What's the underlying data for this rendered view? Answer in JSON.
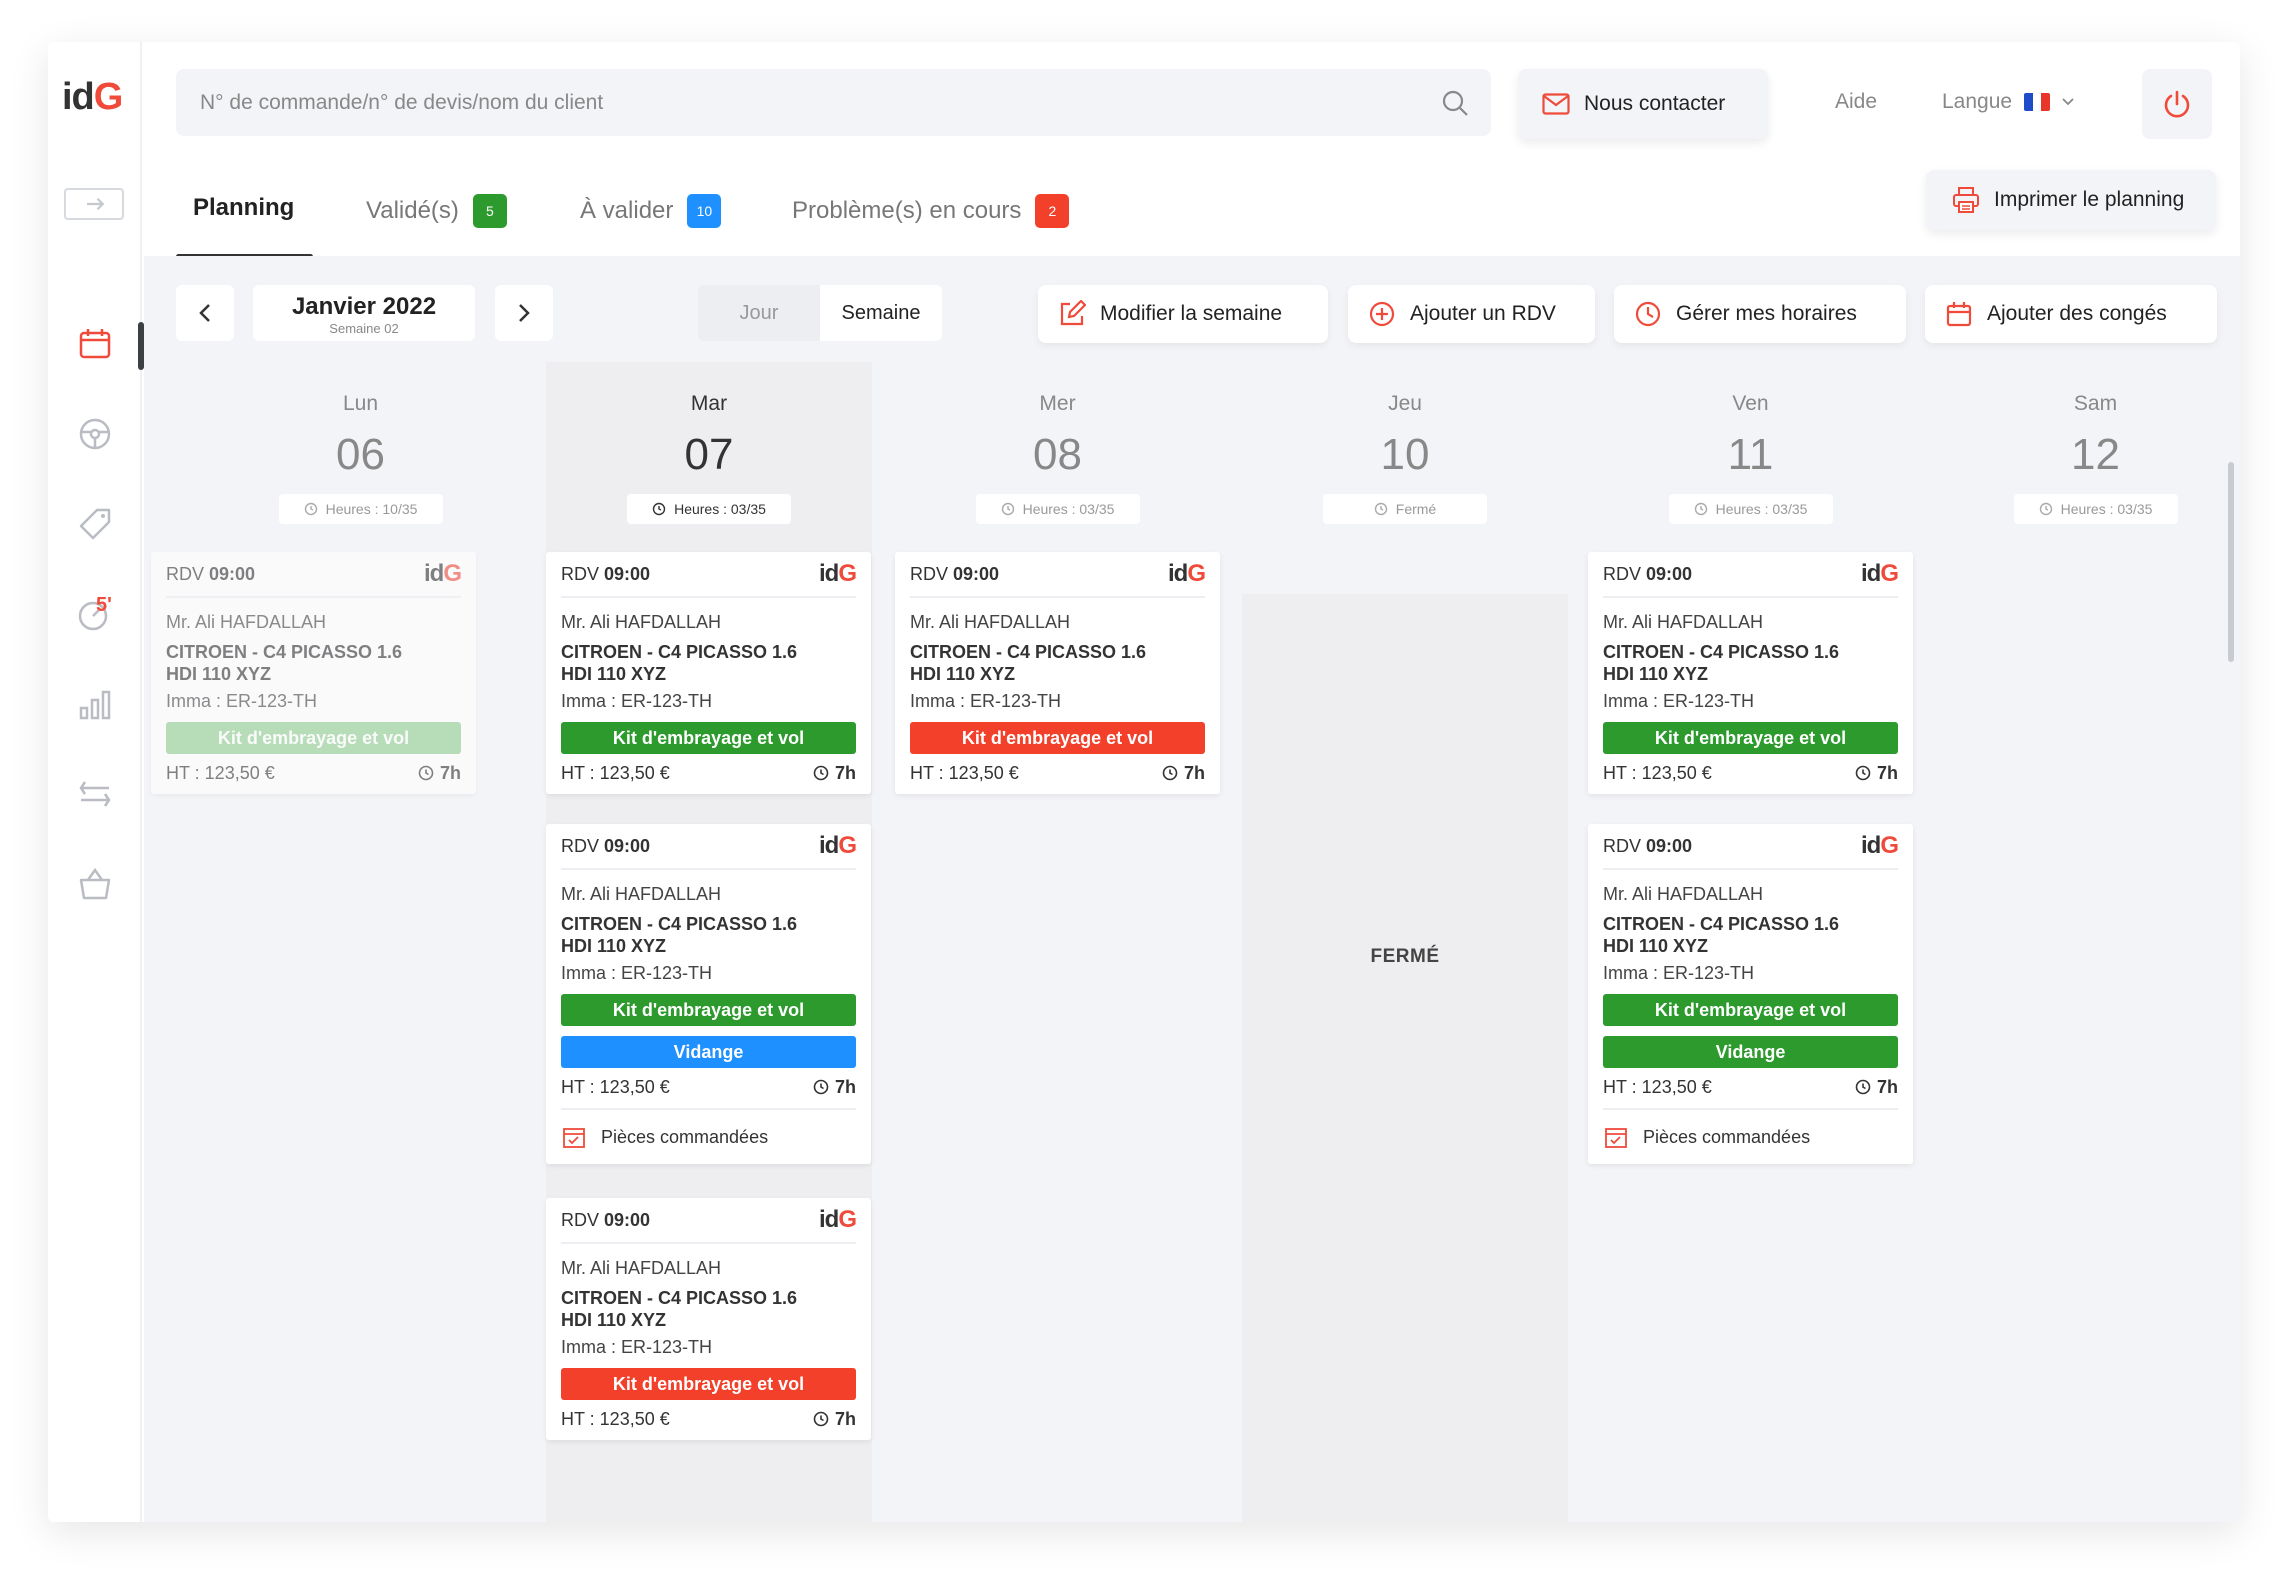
{
  "app": {
    "logo_text": "id",
    "logo_accent": "G"
  },
  "colors": {
    "accent": "#ef4a3a",
    "green": "#2d9a2e",
    "green_light": "#8fcf8f",
    "blue": "#1e90ff",
    "red": "#f2402b"
  },
  "search": {
    "placeholder": "N° de commande/n° de devis/nom du client"
  },
  "header": {
    "contact_label": "Nous contacter",
    "help_label": "Aide",
    "language_label": "Langue"
  },
  "tabs": [
    {
      "label": "Planning"
    },
    {
      "label": "Validé(s)",
      "badge": "5"
    },
    {
      "label": "À valider",
      "badge": "10"
    },
    {
      "label": "Problème(s) en cours",
      "badge": "2"
    }
  ],
  "print_label": "Imprimer le planning",
  "calendar": {
    "month": "Janvier 2022",
    "week": "Semaine 02",
    "view_day": "Jour",
    "view_week": "Semaine"
  },
  "actions": {
    "edit_week": "Modifier la semaine",
    "add_rdv": "Ajouter un RDV",
    "manage_hours": "Gérer mes horaires",
    "add_leave": "Ajouter des congés"
  },
  "days": [
    {
      "name": "Lun",
      "date": "06",
      "hours": "Heures : 10/35"
    },
    {
      "name": "Mar",
      "date": "07",
      "hours": "Heures : 03/35"
    },
    {
      "name": "Mer",
      "date": "08",
      "hours": "Heures : 03/35"
    },
    {
      "name": "Jeu",
      "date": "10",
      "hours": "Fermé"
    },
    {
      "name": "Ven",
      "date": "11",
      "hours": "Heures : 03/35"
    },
    {
      "name": "Sam",
      "date": "12",
      "hours": "Heures : 03/35"
    }
  ],
  "closed_label": "FERMÉ",
  "appointment": {
    "rdv_prefix": "RDV",
    "time": "09:00",
    "client": "Mr. Ali HAFDALLAH",
    "vehicle_line1": "CITROEN - C4 PICASSO 1.6",
    "vehicle_line2": "HDI 110 XYZ",
    "imma": "Imma : ER-123-TH",
    "service_kit": "Kit d'embrayage et vol",
    "service_vidange": "Vidange",
    "price": "HT : 123,50 €",
    "duration": "7h",
    "parts_ordered": "Pièces commandées"
  }
}
